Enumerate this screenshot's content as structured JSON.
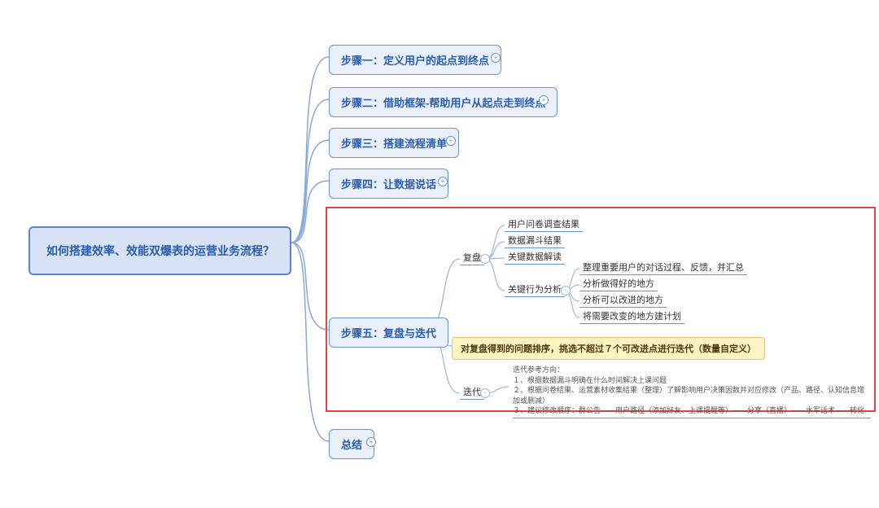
{
  "root": "如何搭建效率、效能双爆表的运营业务流程？",
  "steps": {
    "s1": "步骤一：定义用户的起点到终点",
    "s2": "步骤二：借助框架-帮助用户从起点走到终点",
    "s3": "步骤三：搭建流程清单",
    "s4": "步骤四：让数据说话",
    "s5": "步骤五：复盘与迭代",
    "s6": "总结"
  },
  "step5": {
    "branchA": "复盘",
    "branchA_children": {
      "a1": "用户问卷调查结果",
      "a2": "数据漏斗结果",
      "a3": "关键数据解读",
      "a4": "关键行为分析"
    },
    "branchA4_children": {
      "b1": "整理重要用户的对话过程、反馈，并汇总",
      "b2": "分析做得好的地方",
      "b3": "分析可以改进的地方",
      "b4": "将需要改变的地方建计划"
    },
    "highlight": "对复盘得到的问题排序，挑选不超过７个可改进点进行迭代（数量自定义）",
    "branchB": "迭代",
    "branchB_title": "迭代参考方向：",
    "branchB_lines": {
      "l1": "１、根据数据漏斗明确在什么时间解决上课问题",
      "l2": "２、根据问卷结果、运营素材收集结果（整理）了解影响用户决策因数并对应修改（产品、路径、认知信息增加或删减）",
      "l3": "３、建议修改顺序：群公告——用户路径（添加好友、上课提醒等）——分享（直播）——水军话术——转化"
    }
  }
}
